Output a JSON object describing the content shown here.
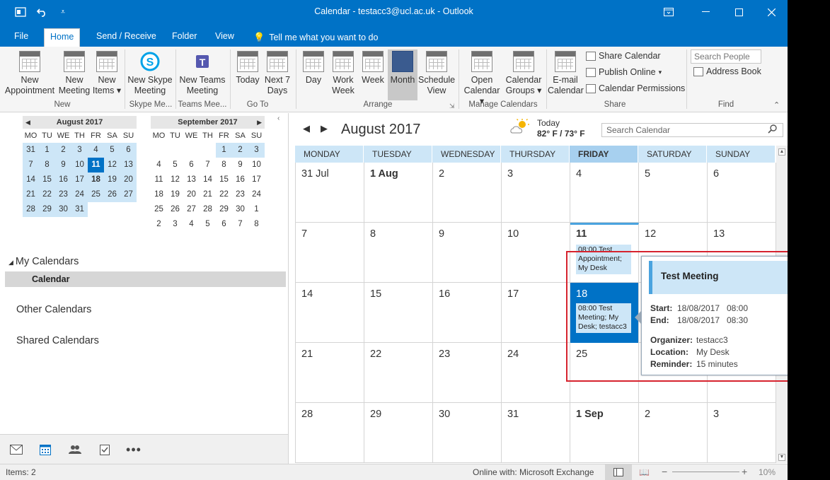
{
  "window": {
    "title": "Calendar - testacc3@ucl.ac.uk - Outlook"
  },
  "tabs": [
    "File",
    "Home",
    "Send / Receive",
    "Folder",
    "View",
    "Tell me what you want to do"
  ],
  "ribbon": {
    "new_appointment": "New\nAppointment",
    "new_meeting": "New\nMeeting",
    "new_items": "New\nItems",
    "group_new": "New",
    "new_skype": "New Skype\nMeeting",
    "group_skype": "Skype Me...",
    "new_teams": "New Teams\nMeeting",
    "group_teams": "Teams Mee...",
    "today": "Today",
    "next7": "Next 7\nDays",
    "group_goto": "Go To",
    "day": "Day",
    "work_week": "Work\nWeek",
    "week": "Week",
    "month": "Month",
    "schedule_view": "Schedule\nView",
    "group_arrange": "Arrange",
    "open_calendar": "Open\nCalendar",
    "calendar_groups": "Calendar\nGroups",
    "group_manage": "Manage Calendars",
    "email_calendar": "E-mail\nCalendar",
    "share_calendar": "Share Calendar",
    "publish_online": "Publish Online",
    "calendar_permissions": "Calendar Permissions",
    "group_share": "Share",
    "search_people": "Search People",
    "address_book": "Address Book",
    "group_find": "Find"
  },
  "minical": {
    "dow": [
      "MO",
      "TU",
      "WE",
      "TH",
      "FR",
      "SA",
      "SU"
    ],
    "aug": {
      "title": "August 2017",
      "days": [
        "31",
        "1",
        "2",
        "3",
        "4",
        "5",
        "6",
        "7",
        "8",
        "9",
        "10",
        "11",
        "12",
        "13",
        "14",
        "15",
        "16",
        "17",
        "18",
        "19",
        "20",
        "21",
        "22",
        "23",
        "24",
        "25",
        "26",
        "27",
        "28",
        "29",
        "30",
        "31",
        "",
        "",
        ""
      ]
    },
    "sep": {
      "title": "September 2017",
      "days": [
        "",
        "",
        "",
        "",
        "1",
        "2",
        "3",
        "4",
        "5",
        "6",
        "7",
        "8",
        "9",
        "10",
        "11",
        "12",
        "13",
        "14",
        "15",
        "16",
        "17",
        "18",
        "19",
        "20",
        "21",
        "22",
        "23",
        "24",
        "25",
        "26",
        "27",
        "28",
        "29",
        "30",
        "1",
        "2",
        "3",
        "4",
        "5",
        "6",
        "7",
        "8"
      ]
    }
  },
  "nav": {
    "my_calendars": "My Calendars",
    "calendar": "Calendar",
    "other_calendars": "Other Calendars",
    "shared_calendars": "Shared Calendars"
  },
  "main": {
    "month_title": "August 2017",
    "weather_day": "Today",
    "weather_temp": "82° F / 73° F",
    "search_placeholder": "Search Calendar",
    "dow": [
      "MONDAY",
      "TUESDAY",
      "WEDNESDAY",
      "THURSDAY",
      "FRIDAY",
      "SATURDAY",
      "SUNDAY"
    ],
    "weeks": [
      [
        "31 Jul",
        "1 Aug",
        "2",
        "3",
        "4",
        "5",
        "6"
      ],
      [
        "7",
        "8",
        "9",
        "10",
        "11",
        "12",
        "13"
      ],
      [
        "14",
        "15",
        "16",
        "17",
        "18",
        "19",
        "20"
      ],
      [
        "21",
        "22",
        "23",
        "24",
        "25",
        "26",
        "27"
      ],
      [
        "28",
        "29",
        "30",
        "31",
        "1 Sep",
        "2",
        "3"
      ]
    ],
    "appt_11": "08:00 Test Appointment; My Desk",
    "appt_18": "08:00 Test Meeting; My Desk; testacc3"
  },
  "popup": {
    "title": "Test Meeting",
    "start_label": "Start:",
    "start_date": "18/08/2017",
    "start_time": "08:00",
    "end_label": "End:",
    "end_date": "18/08/2017",
    "end_time": "08:30",
    "organizer_label": "Organizer:",
    "organizer": "testacc3",
    "location_label": "Location:",
    "location": "My Desk",
    "reminder_label": "Reminder:",
    "reminder": "15 minutes"
  },
  "status": {
    "items": "Items: 2",
    "connection": "Online with: Microsoft Exchange",
    "zoom": "10%"
  }
}
